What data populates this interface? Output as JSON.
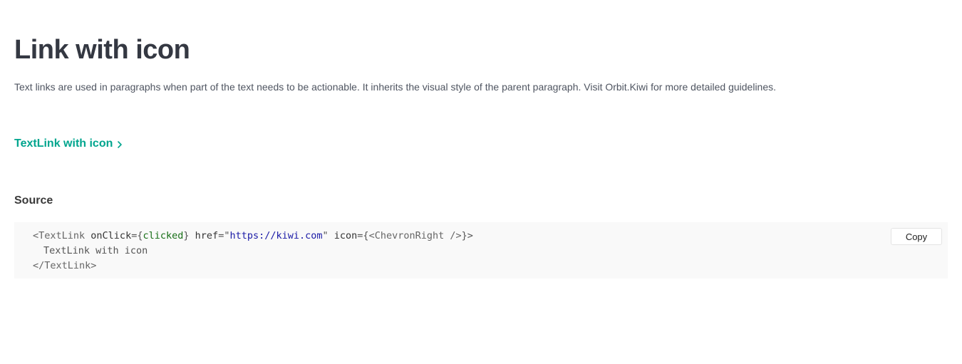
{
  "page": {
    "title": "Link with icon",
    "description": "Text links are used in paragraphs when part of the text needs to be actionable. It inherits the visual style of the parent paragraph. Visit Orbit.Kiwi for more detailed guidelines."
  },
  "example": {
    "link_label": "TextLink with icon",
    "link_icon": "chevron-right-icon",
    "link_color": "#00a58e"
  },
  "source": {
    "heading": "Source",
    "copy_label": "Copy",
    "code": {
      "open_tag": "<TextLink",
      "attr_onclick": "onClick",
      "eq1": "=",
      "brace_open1": "{",
      "onclick_value": "clicked",
      "brace_close1": "}",
      "attr_href": "href",
      "eq2": "=\"",
      "href_value": "https://kiwi.com",
      "quote_close": "\"",
      "attr_icon": "icon",
      "eq3": "={",
      "icon_value": "<ChevronRight />",
      "brace_close3": "}>",
      "child_text": "TextLink with icon",
      "close_tag": "</TextLink>"
    }
  }
}
